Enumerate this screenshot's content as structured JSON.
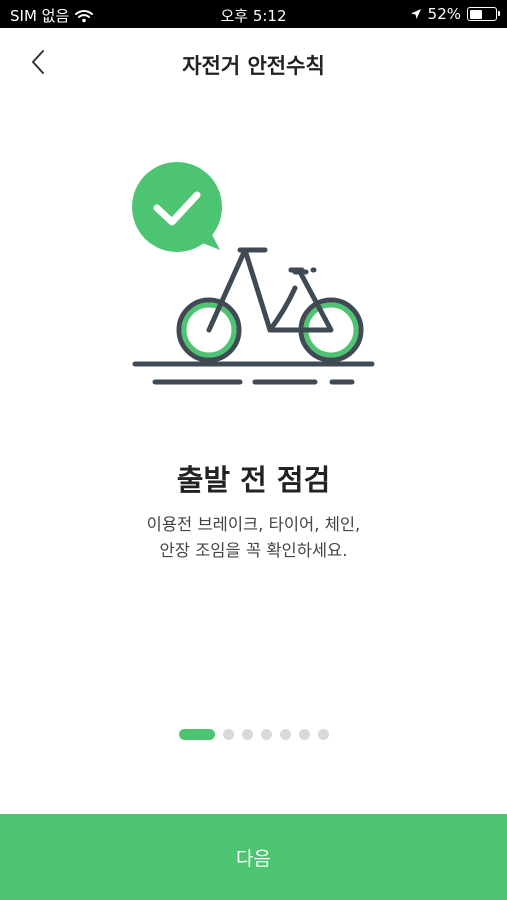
{
  "status_bar": {
    "carrier": "SIM 없음",
    "time": "오후 5:12",
    "battery_percent_label": "52%",
    "battery_level": 0.52
  },
  "header": {
    "title": "자전거 안전수칙",
    "back_icon": "chevron-left-icon"
  },
  "illustration": {
    "icons": [
      "speech-bubble-check-icon",
      "bicycle-icon"
    ]
  },
  "content": {
    "heading": "출발 전 점검",
    "description_line1": "이용전 브레이크, 타이어, 체인,",
    "description_line2": "안장 조임을 꼭 확인하세요."
  },
  "pager": {
    "total": 7,
    "current": 1
  },
  "footer": {
    "next_label": "다음"
  },
  "colors": {
    "accent": "#4cc471",
    "dark": "#3f4a54",
    "dot_inactive": "#d9d9d9"
  }
}
